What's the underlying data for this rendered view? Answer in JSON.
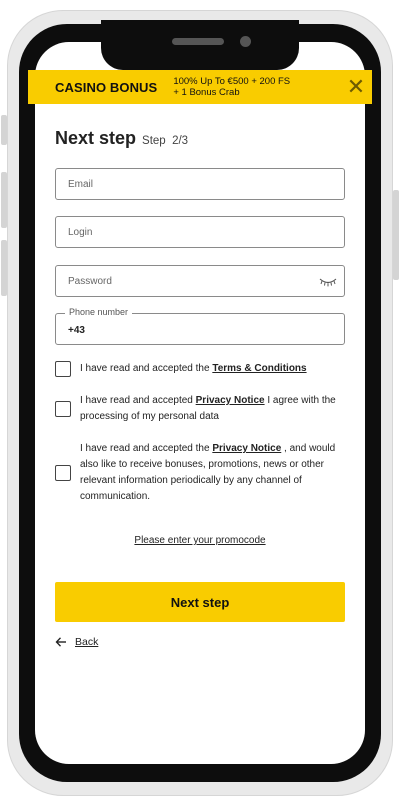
{
  "banner": {
    "title": "CASINO BONUS",
    "line1": "100% Up To €500 + 200 FS",
    "line2": "+ 1 Bonus Crab",
    "close_icon": "close-icon",
    "color": "#f9cc00"
  },
  "heading": {
    "title": "Next step",
    "step_label": "Step",
    "step_value": "2/3"
  },
  "form": {
    "email_placeholder": "Email",
    "login_placeholder": "Login",
    "password_placeholder": "Password",
    "password_icon": "eye-closed-icon",
    "phone_label": "Phone number",
    "phone_value": "+43"
  },
  "checkboxes": [
    {
      "prefix": "I have read and accepted the ",
      "link": "Terms & Conditions",
      "suffix": ""
    },
    {
      "prefix": "I have read and accepted ",
      "link": "Privacy Notice",
      "suffix": " I agree with the processing of my personal data"
    },
    {
      "prefix": "I have read and accepted the ",
      "link": "Privacy Notice",
      "suffix": " , and would also like to receive bonuses, promotions, news or other relevant information periodically by any channel of communication."
    }
  ],
  "promo_link": "Please enter your promocode",
  "next_button": "Next step",
  "back_link": "Back",
  "colors": {
    "accent": "#f9cc00",
    "frame": "#0d0d0d"
  }
}
